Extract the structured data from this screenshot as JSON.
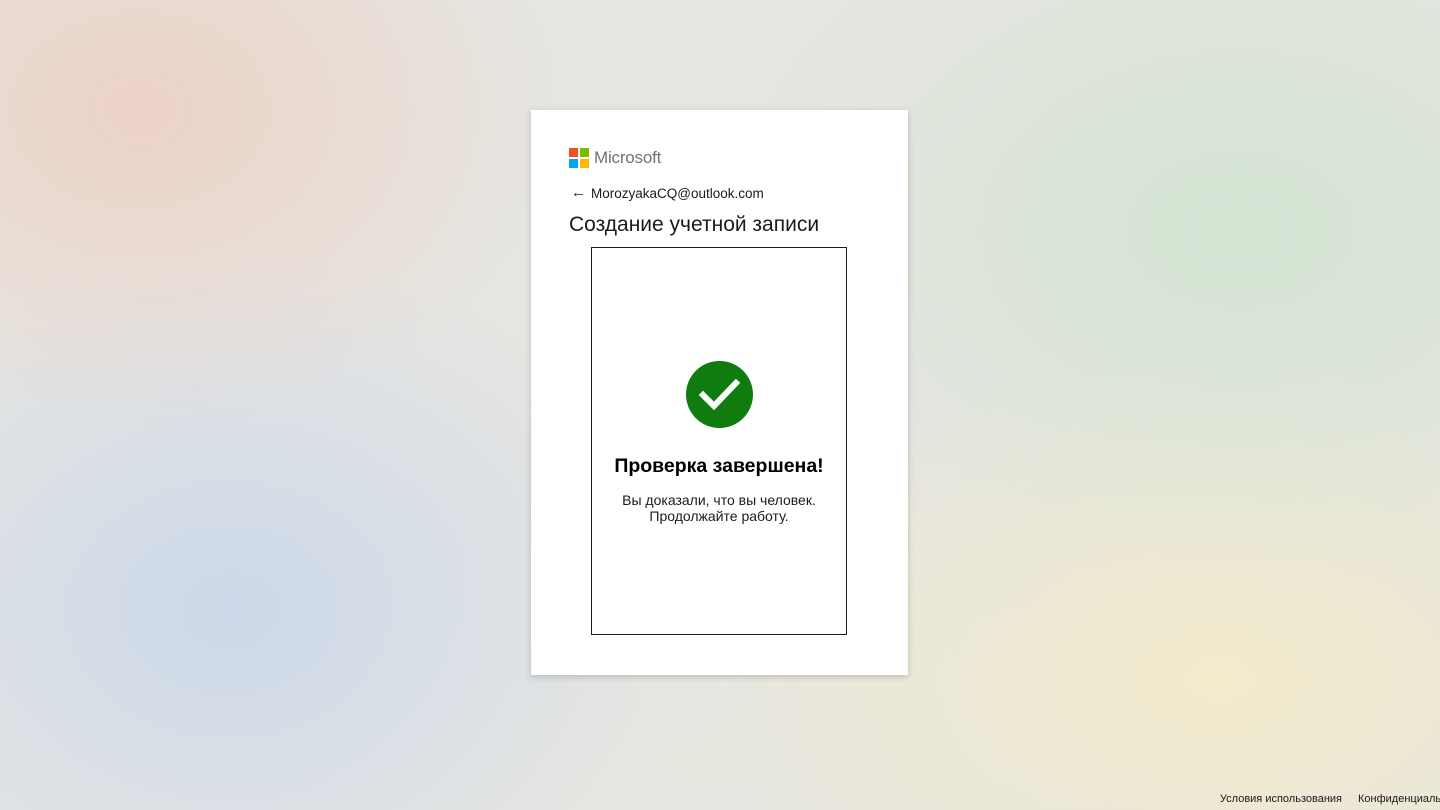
{
  "brand": {
    "name": "Microsoft",
    "logo_colors": [
      "#f25022",
      "#7fba00",
      "#00a4ef",
      "#ffb900"
    ]
  },
  "identity": {
    "back_icon": "arrow-left-icon",
    "email": "MorozyakaCQ@outlook.com"
  },
  "page": {
    "title": "Создание учетной записи"
  },
  "verification": {
    "icon": "checkmark-circle-icon",
    "icon_color": "#107c10",
    "heading": "Проверка завершена!",
    "line1": "Вы доказали, что вы человек.",
    "line2": "Продолжайте работу."
  },
  "footer": {
    "terms": "Условия использования",
    "privacy": "Конфиденциальн"
  }
}
